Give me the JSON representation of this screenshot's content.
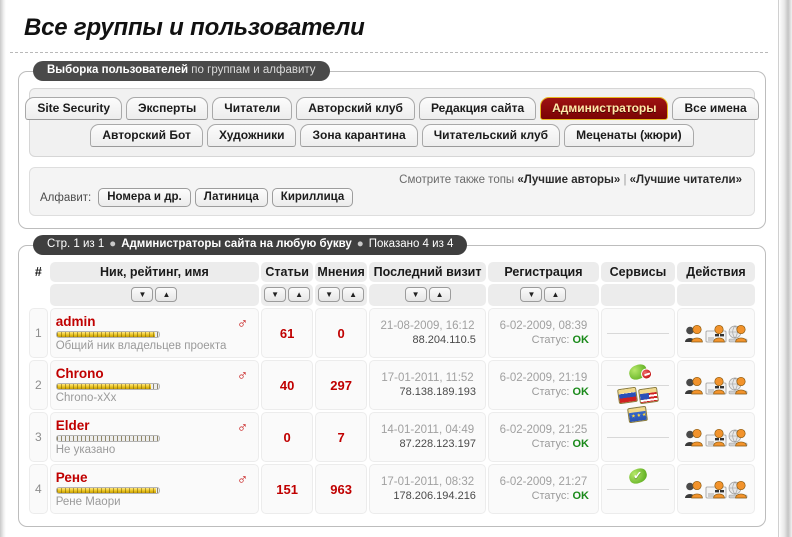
{
  "page": {
    "title": "Все группы и пользователи"
  },
  "selection_panel": {
    "legend_bold": "Выборка пользователей",
    "legend_light": " по группам и алфавиту",
    "tab_rows": [
      [
        {
          "label": "Site Security",
          "active": false
        },
        {
          "label": "Эксперты",
          "active": false
        },
        {
          "label": "Читатели",
          "active": false
        },
        {
          "label": "Авторский клуб",
          "active": false
        },
        {
          "label": "Редакция сайта",
          "active": false
        },
        {
          "label": "Администраторы",
          "active": true
        },
        {
          "label": "Все имена",
          "active": false
        }
      ],
      [
        {
          "label": "Авторский Бот",
          "active": false
        },
        {
          "label": "Художники",
          "active": false
        },
        {
          "label": "Зона карантина",
          "active": false
        },
        {
          "label": "Читательский клуб",
          "active": false
        },
        {
          "label": "Меценаты (жюри)",
          "active": false
        }
      ]
    ],
    "see_also": {
      "prefix": "Смотрите также топы ",
      "link1": "«Лучшие авторы»",
      "separator": " | ",
      "link2": "«Лучшие читатели»"
    },
    "alphabet": {
      "label": "Алфавит:",
      "buttons": [
        "Номера и др.",
        "Латиница",
        "Кириллица"
      ]
    }
  },
  "table_panel": {
    "legend": {
      "page_info": "Стр. 1 из 1",
      "title": "Администраторы сайта на любую букву",
      "shown": "Показано 4 из 4",
      "dot": "●"
    },
    "columns": [
      {
        "key": "num",
        "label": "#",
        "sortable": false
      },
      {
        "key": "user",
        "label": "Ник, рейтинг, имя",
        "sortable": true
      },
      {
        "key": "articles",
        "label": "Статьи",
        "sortable": true
      },
      {
        "key": "opinions",
        "label": "Мнения",
        "sortable": true
      },
      {
        "key": "last_visit",
        "label": "Последний визит",
        "sortable": true
      },
      {
        "key": "registration",
        "label": "Регистрация",
        "sortable": true
      },
      {
        "key": "services",
        "label": "Сервисы",
        "sortable": false
      },
      {
        "key": "actions",
        "label": "Действия",
        "sortable": false
      }
    ],
    "sort_icons": {
      "desc": "▼",
      "asc": "▲"
    },
    "rows": [
      {
        "num": "1",
        "nick": "admin",
        "gender": "♂",
        "rating_percent": 96,
        "realname": "Общий ник владельцев проекта",
        "articles": "61",
        "opinions": "0",
        "last_visit_date": "21-08-2009, 16:12",
        "last_visit_ip": "88.204.110.5",
        "reg_date": "6-02-2009, 08:39",
        "reg_status_label": "Статус:",
        "reg_status_value": "OK",
        "services": {
          "badge": "none",
          "cards": []
        },
        "actions": [
          "profile-icon",
          "message-icon",
          "globe-icon"
        ]
      },
      {
        "num": "2",
        "nick": "Chrono",
        "gender": "♂",
        "rating_percent": 92,
        "realname": "Chrono-xXx",
        "articles": "40",
        "opinions": "297",
        "last_visit_date": "17-01-2011, 11:52",
        "last_visit_ip": "78.138.189.193",
        "reg_date": "6-02-2009, 21:19",
        "reg_status_label": "Статус:",
        "reg_status_value": "OK",
        "services": {
          "badge": "leaf-blocked",
          "cards": [
            "card-ru",
            "card-us",
            "card-eu"
          ]
        },
        "actions": [
          "profile-icon",
          "message-icon",
          "globe-icon"
        ]
      },
      {
        "num": "3",
        "nick": "Elder",
        "gender": "♂",
        "rating_percent": 0,
        "realname": "Не указано",
        "articles": "0",
        "opinions": "7",
        "last_visit_date": "14-01-2011, 04:49",
        "last_visit_ip": "87.228.123.197",
        "reg_date": "6-02-2009, 21:25",
        "reg_status_label": "Статус:",
        "reg_status_value": "OK",
        "services": {
          "badge": "none",
          "cards": []
        },
        "actions": [
          "profile-icon",
          "message-icon",
          "globe-icon"
        ]
      },
      {
        "num": "4",
        "nick": "Рене",
        "gender": "♂",
        "rating_percent": 97,
        "realname": "Рене Маори",
        "articles": "151",
        "opinions": "963",
        "last_visit_date": "17-01-2011, 08:32",
        "last_visit_ip": "178.206.194.216",
        "reg_date": "6-02-2009, 21:27",
        "reg_status_label": "Статус:",
        "reg_status_value": "OK",
        "services": {
          "badge": "leaf-ok",
          "cards": []
        },
        "actions": [
          "profile-icon",
          "message-icon",
          "globe-icon"
        ]
      }
    ]
  },
  "colors": {
    "accent_red": "#c00000",
    "active_tab_bg": "#8c0a0a",
    "active_tab_text": "#ffe9a8",
    "active_tab_border": "#e8b720",
    "legend_bg": "#434343",
    "status_ok": "#1a8a1a",
    "rating_gold": "#e8c21c"
  }
}
